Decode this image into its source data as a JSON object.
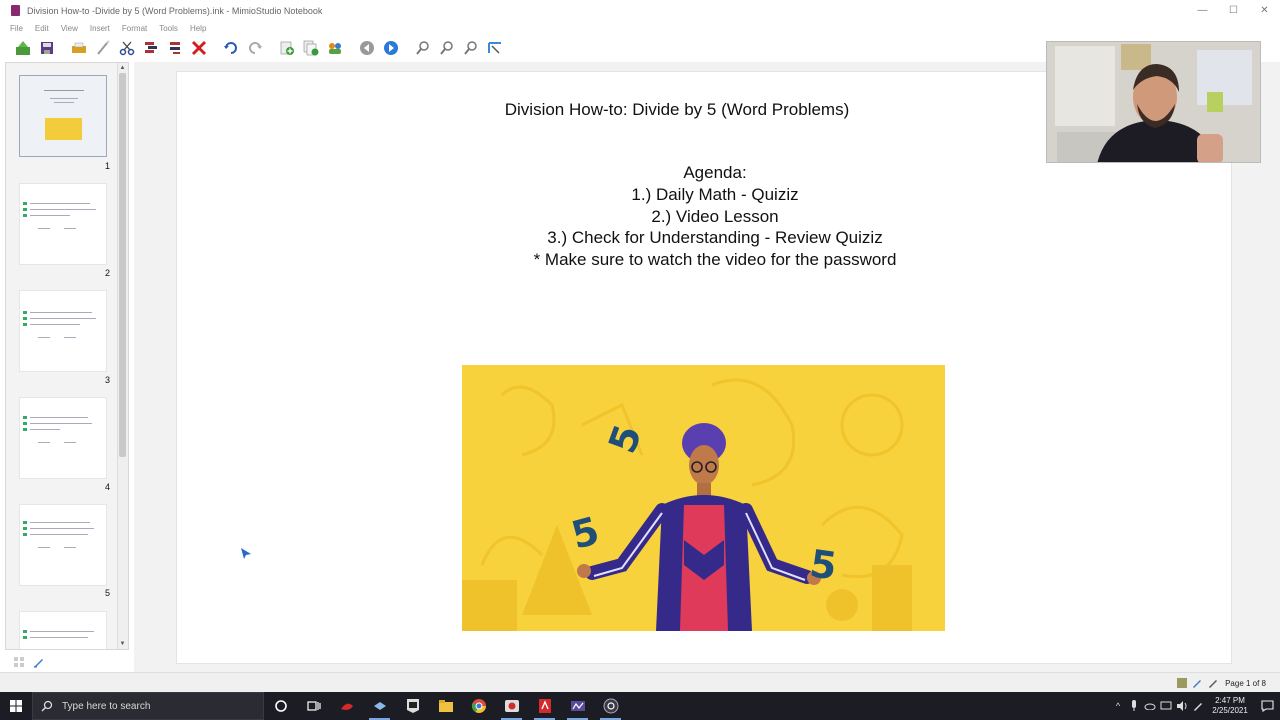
{
  "window": {
    "title": "Division How-to -Divide by 5 (Word Problems).ink - MimioStudio Notebook",
    "minimize": "—",
    "maximize": "☐",
    "close": "✕"
  },
  "menu": [
    "File",
    "Edit",
    "View",
    "Insert",
    "Format",
    "Tools",
    "Help"
  ],
  "toolbar": {
    "icons": [
      "open-icon",
      "save-icon",
      "print-icon",
      "wand-icon",
      "cut-icon",
      "copy-icon",
      "paste-icon",
      "delete-icon",
      "undo-icon",
      "redo-icon",
      "add-page-icon",
      "duplicate-page-icon",
      "people-icon",
      "back-icon",
      "forward-icon",
      "zoom-in-icon",
      "zoom-out-icon",
      "zoom-fit-icon",
      "page-size-icon"
    ]
  },
  "thumbnails": [
    {
      "number": "1"
    },
    {
      "number": "2"
    },
    {
      "number": "3"
    },
    {
      "number": "4"
    },
    {
      "number": "5"
    }
  ],
  "slide": {
    "title": "Division How-to: Divide by 5 (Word Problems)",
    "agenda": [
      "Agenda:",
      "1.) Daily Math - Quiziz",
      "2.) Video Lesson",
      "3.) Check for Understanding - Review Quiziz",
      "* Make sure to watch the video for the password"
    ],
    "image_numbers": [
      "5",
      "5",
      "5"
    ],
    "hero_color": "#f7d23c",
    "number_color": "#1f4f78"
  },
  "status": {
    "page_indicator": "Page 1 of 8"
  },
  "taskbar": {
    "search_placeholder": "Type here to search",
    "time": "2:47 PM",
    "date": "2/25/2021"
  }
}
